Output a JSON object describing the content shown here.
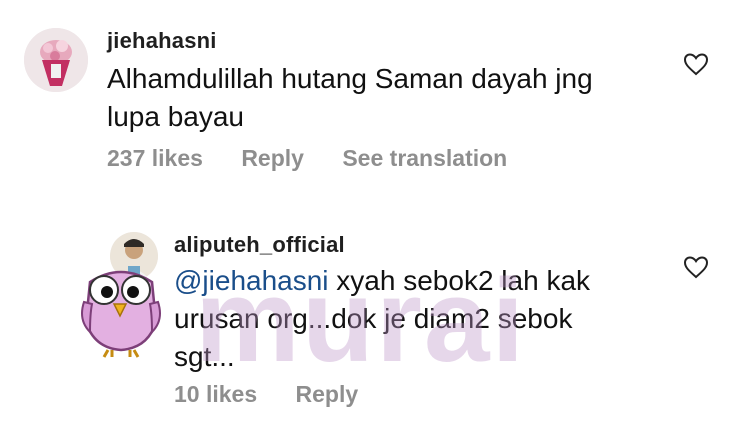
{
  "comments": [
    {
      "username": "jiehahasni",
      "text_line1": "Alhamdulillah hutang Saman dayah jng",
      "text_line2": "lupa bayau",
      "likes": "237 likes",
      "reply": "Reply",
      "translate": "See translation"
    },
    {
      "username": "aliputeh_official",
      "mention": "@jiehahasni",
      "text_line1_rest": " xyah sebok2 lah kak",
      "text_line2": "urusan org...dok je diam2 sebok",
      "text_line3": "sgt...",
      "likes": "10 likes",
      "reply": "Reply"
    }
  ],
  "watermark": {
    "text": "murai"
  },
  "icons": {
    "like": "heart-outline-icon",
    "avatar1": "bouquet-avatar",
    "avatar2": "person-avatar",
    "mascot": "owl-mascot"
  },
  "colors": {
    "text": "#111111",
    "meta": "#8e8e8e",
    "mention": "#1a4e8a",
    "watermark": "#be96c8"
  }
}
